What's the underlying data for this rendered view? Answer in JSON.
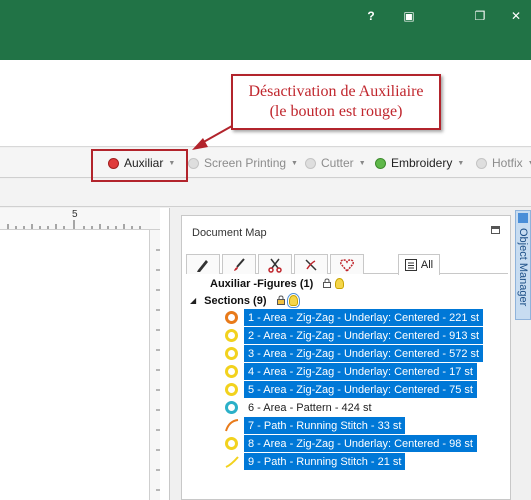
{
  "window_controls": {
    "help": "?",
    "restore_ribbon": "▣",
    "restore": "❐",
    "close": "✕"
  },
  "toolbar": {
    "items": [
      {
        "label": "Auxiliar",
        "dot_color": "#e03a3a",
        "active": true
      },
      {
        "label": "Screen Printing",
        "dot_color": "#d6d6d6",
        "active": false
      },
      {
        "label": "Cutter",
        "dot_color": "#d6d6d6",
        "active": false
      },
      {
        "label": "Embroidery",
        "dot_color": "#5fb84a",
        "active": true
      },
      {
        "label": "Hotfix",
        "dot_color": "#d6d6d6",
        "active": false
      }
    ]
  },
  "callout": {
    "line1": "Désactivation de Auxiliaire",
    "line2": "(le bouton est rouge)"
  },
  "ruler": {
    "top_mark": "5"
  },
  "document_map": {
    "title": "Document Map",
    "tabs": [
      {
        "icon": "pencil-icon"
      },
      {
        "icon": "brush-icon"
      },
      {
        "icon": "scissors-icon"
      },
      {
        "icon": "needle-icon"
      },
      {
        "icon": "heart-icon"
      },
      {
        "icon": "list-icon",
        "label": "All"
      }
    ],
    "groups": [
      {
        "label": "Auxiliar -Figures (1)"
      },
      {
        "label": "Sections (9)"
      }
    ],
    "items": [
      {
        "label": "1 - Area - Zig-Zag - Underlay: Centered - 221 st",
        "color": "#e87a1a",
        "kind": "area"
      },
      {
        "label": "2 - Area - Zig-Zag - Underlay: Centered - 913 st",
        "color": "#f2d21e",
        "kind": "area"
      },
      {
        "label": "3 - Area - Zig-Zag - Underlay: Centered - 572 st",
        "color": "#f2d21e",
        "kind": "area"
      },
      {
        "label": "4 - Area - Zig-Zag - Underlay: Centered - 17 st",
        "color": "#f2d21e",
        "kind": "area"
      },
      {
        "label": "5 - Area - Zig-Zag - Underlay: Centered - 75 st",
        "color": "#f2d21e",
        "kind": "area"
      },
      {
        "label": "6 - Area - Pattern - 424 st",
        "color": "#2bb0c8",
        "kind": "area"
      },
      {
        "label": "7 - Path - Running Stitch - 33 st",
        "color": "#e87a1a",
        "kind": "path"
      },
      {
        "label": "8 - Area - Zig-Zag - Underlay: Centered - 98 st",
        "color": "#f2d21e",
        "kind": "area"
      },
      {
        "label": "9 - Path - Running Stitch - 21 st",
        "color": "#f2d21e",
        "kind": "path"
      }
    ]
  },
  "object_manager": {
    "label": "Object Manager"
  },
  "colors": {
    "title_bar": "#217346",
    "selection": "#0078d7",
    "callout_red": "#b2242c"
  }
}
